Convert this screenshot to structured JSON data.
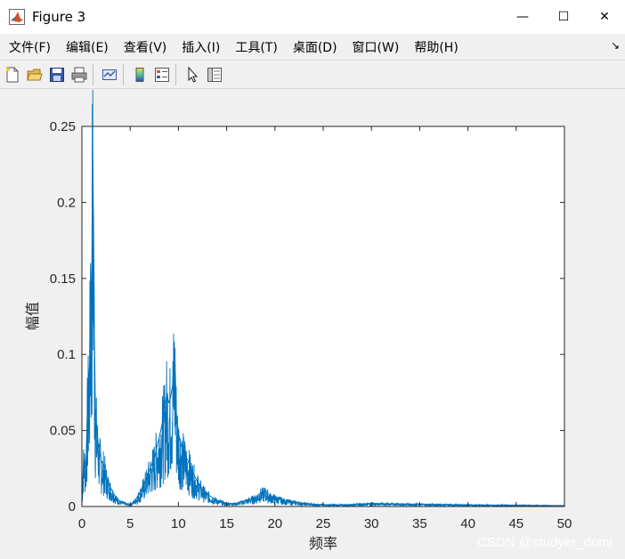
{
  "window": {
    "title": "Figure 3",
    "minimize_glyph": "—",
    "maximize_glyph": "☐",
    "close_glyph": "✕"
  },
  "menu": [
    "文件(F)",
    "编辑(E)",
    "查看(V)",
    "插入(I)",
    "工具(T)",
    "桌面(D)",
    "窗口(W)",
    "帮助(H)"
  ],
  "dock_glyph": "↘",
  "toolbar": {
    "icons": [
      "new-figure-icon",
      "open-file-icon",
      "save-icon",
      "print-icon",
      "link-plot-icon",
      "colorbar-icon",
      "legend-icon",
      "select-arrow-icon",
      "property-inspector-icon"
    ]
  },
  "watermark": "CSDN @studyer_domi",
  "colors": {
    "line": "#0072bd",
    "axes": "#262626",
    "figure_bg": "#f0f0f0",
    "plot_bg": "#ffffff"
  },
  "chart_data": {
    "type": "line",
    "title": "",
    "xlabel": "频率",
    "ylabel": "幅值",
    "xlim": [
      0,
      50
    ],
    "ylim": [
      0,
      0.25
    ],
    "xticks": [
      0,
      5,
      10,
      15,
      20,
      25,
      30,
      35,
      40,
      45,
      50
    ],
    "xtick_labels": [
      "0",
      "5",
      "10",
      "15",
      "20",
      "25",
      "30",
      "35",
      "40",
      "45",
      "50"
    ],
    "yticks": [
      0,
      0.05,
      0.1,
      0.15,
      0.2,
      0.25
    ],
    "ytick_labels": [
      "0",
      "0.05",
      "0.1",
      "0.15",
      "0.2",
      "0.25"
    ],
    "grid": false,
    "box": true,
    "series": [
      {
        "color": "#0072bd",
        "x": [
          0,
          0.2,
          0.4,
          0.6,
          0.8,
          0.9,
          1.0,
          1.1,
          1.2,
          1.3,
          1.4,
          1.5,
          1.7,
          2.0,
          2.3,
          2.6,
          3.0,
          3.5,
          4.0,
          4.5,
          5.0,
          5.5,
          6.0,
          6.5,
          7.0,
          7.5,
          8.0,
          8.5,
          8.8,
          9.0,
          9.2,
          9.4,
          9.6,
          9.8,
          10.0,
          10.3,
          10.6,
          11.0,
          11.5,
          12.0,
          12.5,
          13.0,
          13.5,
          14.0,
          15.0,
          16.0,
          17.0,
          18.0,
          18.5,
          19.0,
          19.5,
          20.0,
          21.0,
          22.0,
          23.0,
          24.0,
          25.0,
          27.0,
          30.0,
          35.0,
          40.0,
          45.0,
          50.0
        ],
        "y": [
          0.002,
          0.035,
          0.025,
          0.07,
          0.095,
          0.16,
          0.12,
          0.238,
          0.19,
          0.11,
          0.062,
          0.055,
          0.04,
          0.03,
          0.027,
          0.018,
          0.012,
          0.006,
          0.003,
          0.002,
          0.001,
          0.004,
          0.009,
          0.016,
          0.024,
          0.032,
          0.045,
          0.06,
          0.075,
          0.068,
          0.072,
          0.08,
          0.105,
          0.06,
          0.048,
          0.04,
          0.035,
          0.03,
          0.022,
          0.016,
          0.011,
          0.008,
          0.006,
          0.004,
          0.002,
          0.002,
          0.004,
          0.006,
          0.009,
          0.01,
          0.007,
          0.006,
          0.004,
          0.003,
          0.002,
          0.0015,
          0.0012,
          0.001,
          0.002,
          0.0015,
          0.001,
          0.0008,
          0.0005
        ]
      }
    ]
  }
}
